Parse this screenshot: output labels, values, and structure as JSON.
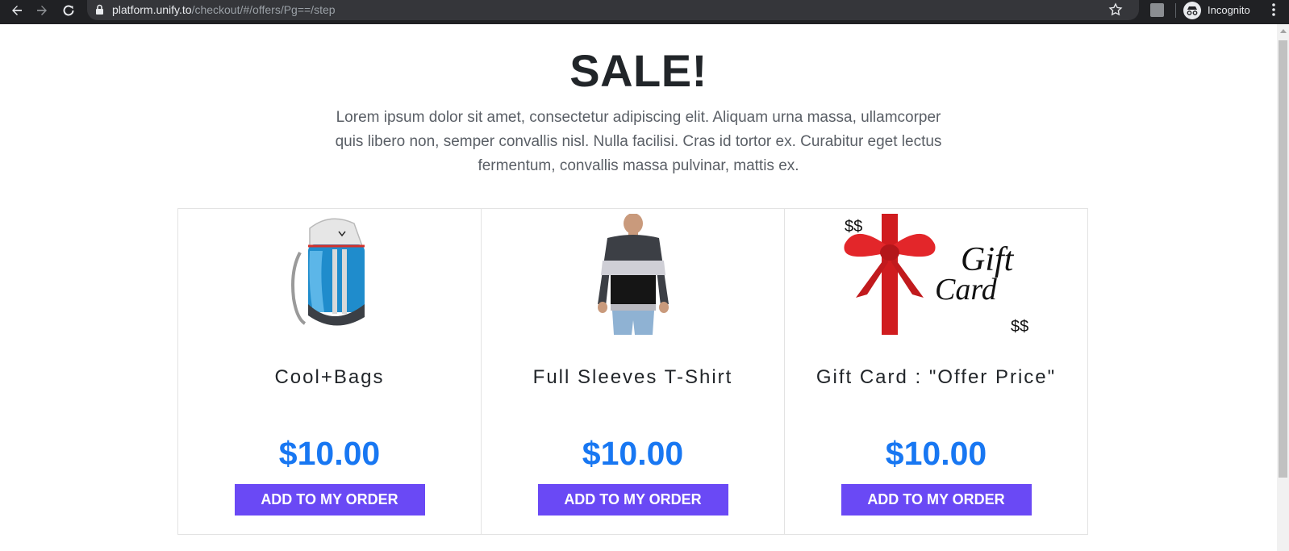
{
  "browser": {
    "url_host": "platform.unify.to",
    "url_path": "/checkout/#/offers/Pg==/step",
    "incognito_label": "Incognito"
  },
  "page": {
    "title": "SALE!",
    "description": "Lorem ipsum dolor sit amet, consectetur adipiscing elit. Aliquam urna massa, ullamcorper quis libero non, semper convallis nisl. Nulla facilisi. Cras id tortor ex. Curabitur eget lectus fermentum, convallis massa pulvinar, mattis ex."
  },
  "products": [
    {
      "name": "Cool+Bags",
      "price": "$10.00",
      "button": "ADD TO MY ORDER",
      "image": "backpack-image"
    },
    {
      "name": "Full Sleeves T-Shirt",
      "price": "$10.00",
      "button": "ADD TO MY ORDER",
      "image": "tshirt-image"
    },
    {
      "name": "Gift Card : \"Offer Price\"",
      "price": "$10.00",
      "button": "ADD TO MY ORDER",
      "image": "gift-card-image",
      "image_text": {
        "gift": "Gift",
        "card": "Card",
        "dollars": "$$"
      }
    }
  ],
  "colors": {
    "accent_price": "#1877f2",
    "button_bg": "#6a49f5",
    "chrome_bg": "#202124"
  }
}
